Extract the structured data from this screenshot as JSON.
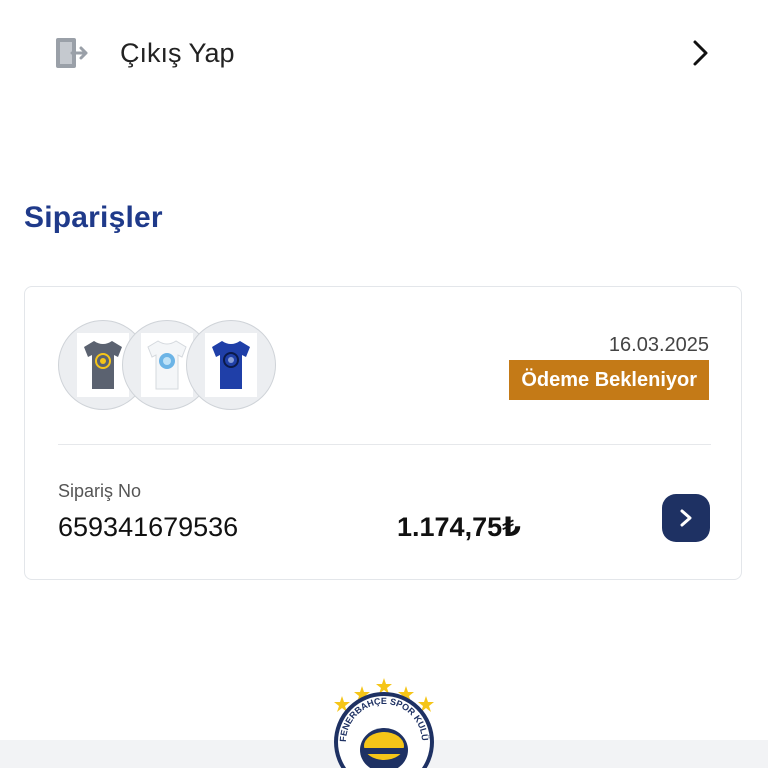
{
  "menu": {
    "logout_label": "Çıkış Yap",
    "logout_icon": "logout-door-icon",
    "chevron_icon": "chevron-right-icon"
  },
  "orders_section": {
    "title": "Siparişler"
  },
  "order": {
    "date": "16.03.2025",
    "status": "Ödeme Bekleniyor",
    "order_no_label": "Sipariş No",
    "order_no": "659341679536",
    "total": "1.174,75₺",
    "products": [
      {
        "name": "tshirt-thumbnail-gray",
        "color": "#5b6270"
      },
      {
        "name": "tshirt-thumbnail-white",
        "color": "#f4f6f8"
      },
      {
        "name": "tshirt-thumbnail-blue",
        "color": "#1f3fa8"
      }
    ]
  },
  "brand": {
    "logo_text": "FENERBAHÇE SPOR KULÜBÜ",
    "star_color": "#f5c518",
    "navy": "#1e3163",
    "status_color": "#c47a17",
    "title_color": "#1f3a8a"
  }
}
